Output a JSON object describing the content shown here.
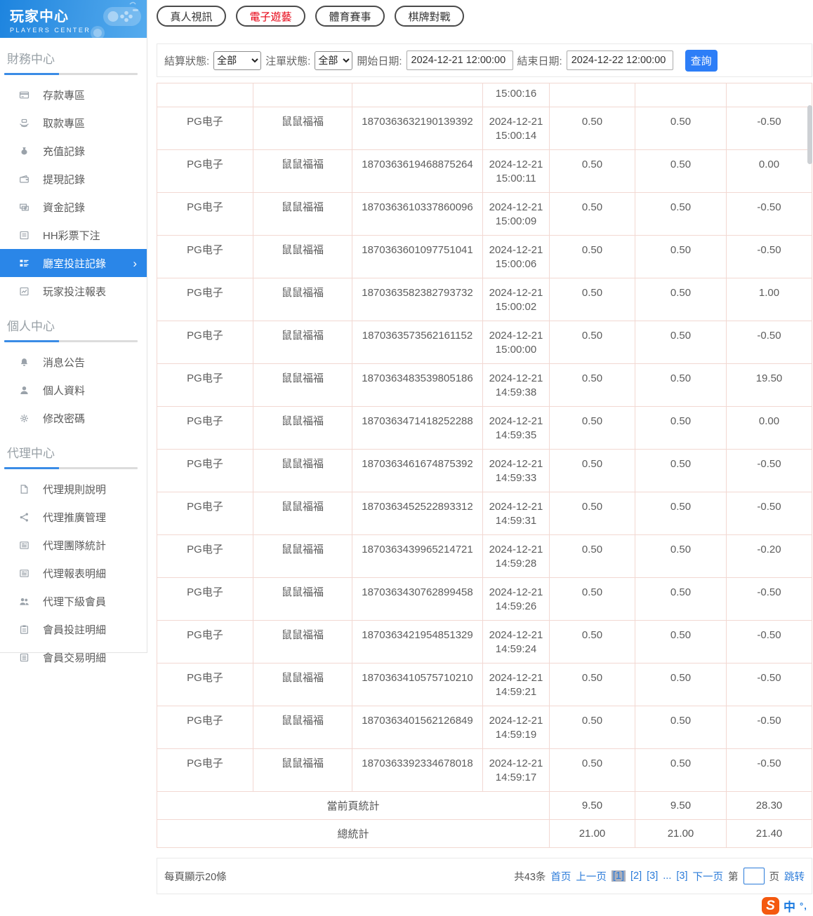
{
  "colors": {
    "accent_blue": "#2a86e8",
    "button_blue": "#2d7ef7",
    "link_blue": "#2b7bd9",
    "active_tab_red": "#e60012",
    "table_border_pink": "#f2d8d2",
    "header_gradient_start": "#1d84df",
    "header_gradient_end": "#55abee"
  },
  "sidebar": {
    "title": "玩家中心",
    "subtitle": "PLAYERS CENTER",
    "sections": [
      {
        "heading": "財務中心",
        "items": [
          {
            "label": "存款專區",
            "icon": "card",
            "active": false
          },
          {
            "label": "取款專區",
            "icon": "hand-coin",
            "active": false
          },
          {
            "label": "充值記錄",
            "icon": "money-bag",
            "active": false
          },
          {
            "label": "提現記錄",
            "icon": "wallet",
            "active": false
          },
          {
            "label": "資金記錄",
            "icon": "banknotes",
            "active": false
          },
          {
            "label": "HH彩票下注",
            "icon": "list",
            "active": false
          },
          {
            "label": "廳室投註記錄",
            "icon": "room-list",
            "active": true
          },
          {
            "label": "玩家投注報表",
            "icon": "chart",
            "active": false
          }
        ]
      },
      {
        "heading": "個人中心",
        "items": [
          {
            "label": "消息公告",
            "icon": "bell",
            "active": false
          },
          {
            "label": "個人資料",
            "icon": "person",
            "active": false
          },
          {
            "label": "修改密碼",
            "icon": "gear",
            "active": false
          }
        ]
      },
      {
        "heading": "代理中心",
        "items": [
          {
            "label": "代理規則說明",
            "icon": "document",
            "active": false
          },
          {
            "label": "代理推廣管理",
            "icon": "share",
            "active": false
          },
          {
            "label": "代理團隊統計",
            "icon": "news",
            "active": false
          },
          {
            "label": "代理報表明細",
            "icon": "news",
            "active": false
          },
          {
            "label": "代理下級會員",
            "icon": "people",
            "active": false
          },
          {
            "label": "會員投註明細",
            "icon": "clipboard",
            "active": false
          },
          {
            "label": "會員交易明細",
            "icon": "list-doc",
            "active": false
          }
        ]
      }
    ]
  },
  "tabs": [
    {
      "label": "真人視訊",
      "active": false
    },
    {
      "label": "電子遊藝",
      "active": true
    },
    {
      "label": "體育賽事",
      "active": false
    },
    {
      "label": "棋牌對戰",
      "active": false
    }
  ],
  "filters": {
    "settle_label": "結算狀態:",
    "settle_value": "全部",
    "order_label": "注單狀態:",
    "order_value": "全部",
    "start_label": "開始日期:",
    "start_value": "2024-12-21 12:00:00",
    "end_label": "結束日期:",
    "end_value": "2024-12-22 12:00:00",
    "search_label": "查詢"
  },
  "table": {
    "partial_row_time": "15:00:16",
    "rows": [
      {
        "platform": "PG电子",
        "game": "鼠鼠福福",
        "order_id": "1870363632190139392",
        "time": "2024-12-21 15:00:14",
        "bet": "0.50",
        "valid_bet": "0.50",
        "win_loss": "-0.50"
      },
      {
        "platform": "PG电子",
        "game": "鼠鼠福福",
        "order_id": "1870363619468875264",
        "time": "2024-12-21 15:00:11",
        "bet": "0.50",
        "valid_bet": "0.50",
        "win_loss": "0.00"
      },
      {
        "platform": "PG电子",
        "game": "鼠鼠福福",
        "order_id": "1870363610337860096",
        "time": "2024-12-21 15:00:09",
        "bet": "0.50",
        "valid_bet": "0.50",
        "win_loss": "-0.50"
      },
      {
        "platform": "PG电子",
        "game": "鼠鼠福福",
        "order_id": "1870363601097751041",
        "time": "2024-12-21 15:00:06",
        "bet": "0.50",
        "valid_bet": "0.50",
        "win_loss": "-0.50"
      },
      {
        "platform": "PG电子",
        "game": "鼠鼠福福",
        "order_id": "1870363582382793732",
        "time": "2024-12-21 15:00:02",
        "bet": "0.50",
        "valid_bet": "0.50",
        "win_loss": "1.00"
      },
      {
        "platform": "PG电子",
        "game": "鼠鼠福福",
        "order_id": "1870363573562161152",
        "time": "2024-12-21 15:00:00",
        "bet": "0.50",
        "valid_bet": "0.50",
        "win_loss": "-0.50"
      },
      {
        "platform": "PG电子",
        "game": "鼠鼠福福",
        "order_id": "1870363483539805186",
        "time": "2024-12-21 14:59:38",
        "bet": "0.50",
        "valid_bet": "0.50",
        "win_loss": "19.50"
      },
      {
        "platform": "PG电子",
        "game": "鼠鼠福福",
        "order_id": "1870363471418252288",
        "time": "2024-12-21 14:59:35",
        "bet": "0.50",
        "valid_bet": "0.50",
        "win_loss": "0.00"
      },
      {
        "platform": "PG电子",
        "game": "鼠鼠福福",
        "order_id": "1870363461674875392",
        "time": "2024-12-21 14:59:33",
        "bet": "0.50",
        "valid_bet": "0.50",
        "win_loss": "-0.50"
      },
      {
        "platform": "PG电子",
        "game": "鼠鼠福福",
        "order_id": "1870363452522893312",
        "time": "2024-12-21 14:59:31",
        "bet": "0.50",
        "valid_bet": "0.50",
        "win_loss": "-0.50"
      },
      {
        "platform": "PG电子",
        "game": "鼠鼠福福",
        "order_id": "1870363439965214721",
        "time": "2024-12-21 14:59:28",
        "bet": "0.50",
        "valid_bet": "0.50",
        "win_loss": "-0.20"
      },
      {
        "platform": "PG电子",
        "game": "鼠鼠福福",
        "order_id": "1870363430762899458",
        "time": "2024-12-21 14:59:26",
        "bet": "0.50",
        "valid_bet": "0.50",
        "win_loss": "-0.50"
      },
      {
        "platform": "PG电子",
        "game": "鼠鼠福福",
        "order_id": "1870363421954851329",
        "time": "2024-12-21 14:59:24",
        "bet": "0.50",
        "valid_bet": "0.50",
        "win_loss": "-0.50"
      },
      {
        "platform": "PG电子",
        "game": "鼠鼠福福",
        "order_id": "1870363410575710210",
        "time": "2024-12-21 14:59:21",
        "bet": "0.50",
        "valid_bet": "0.50",
        "win_loss": "-0.50"
      },
      {
        "platform": "PG电子",
        "game": "鼠鼠福福",
        "order_id": "1870363401562126849",
        "time": "2024-12-21 14:59:19",
        "bet": "0.50",
        "valid_bet": "0.50",
        "win_loss": "-0.50"
      },
      {
        "platform": "PG电子",
        "game": "鼠鼠福福",
        "order_id": "1870363392334678018",
        "time": "2024-12-21 14:59:17",
        "bet": "0.50",
        "valid_bet": "0.50",
        "win_loss": "-0.50"
      }
    ],
    "summary_rows": [
      {
        "label": "當前頁統計",
        "bet": "9.50",
        "valid_bet": "9.50",
        "win_loss": "28.30"
      },
      {
        "label": "總統計",
        "bet": "21.00",
        "valid_bet": "21.00",
        "win_loss": "21.40"
      }
    ]
  },
  "pagination": {
    "page_size_text": "每頁顯示20條",
    "total_text": "共43条",
    "first_label": "首页",
    "prev_label": "上一页",
    "pages": [
      {
        "label": "[1]",
        "current": true
      },
      {
        "label": "[2]",
        "current": false
      },
      {
        "label": "[3]",
        "current": false
      },
      {
        "label": "...",
        "current": false,
        "ellipsis": true
      },
      {
        "label": "[3]",
        "current": false
      }
    ],
    "next_label": "下一页",
    "jump_prefix": "第",
    "jump_value": "",
    "jump_suffix": "页",
    "jump_label": "跳转"
  },
  "ime": {
    "logo_letter": "S",
    "lang_label": "中",
    "marks": "°,"
  }
}
